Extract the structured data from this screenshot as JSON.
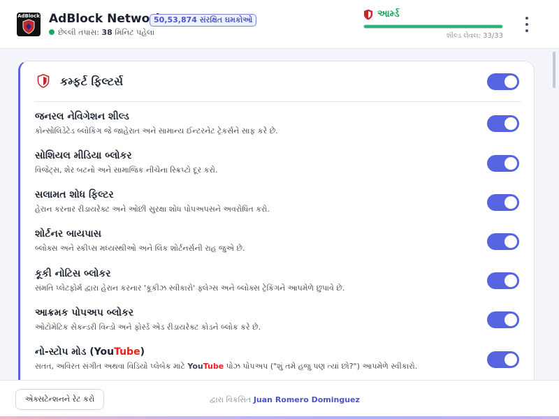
{
  "header": {
    "logo_text": "AdBlock",
    "app_title": "AdBlock Network",
    "users_badge": "50,53,874 સંરક્ષિત ઘમકોઓ",
    "status_prefix": "છેલ્લી તપાસ:",
    "status_value": "38",
    "status_suffix": "મિનિટ પહેલાં",
    "armed_label": "આર્મ્ડ",
    "shield_level": "શીલ્ડ લેવલ: 33/33",
    "shield_progress": 1.0
  },
  "card": {
    "title": "કમ્ફર્ટ ફિલ્ટર્સ",
    "master_enabled": true,
    "filters": [
      {
        "name": "જનરલ નેવિગેશન શીલ્ડ",
        "desc": "કોન્સોલિડેટેડ બ્લોકિંગ જે જાહેરાત અને સામાન્ય ઈન્ટરનેટ ટ્રેકર્સને સાફ કરે છે.",
        "enabled": true
      },
      {
        "name": "સોશિયલ મીડિયા બ્લોકર",
        "desc": "વિજેટ્સ, શેર બટનો અને સામાજિક નીચેના સ્ક્રિપ્ટો દૂર કરો.",
        "enabled": true
      },
      {
        "name": "સલામત શોધ ફિલ્ટર",
        "desc": "હેરાન કરનાર રીડાયરેક્ટ અને ઓછી સુરક્ષા શોધ પોપઅપસને અવરોધિત કરો.",
        "enabled": true
      },
      {
        "name": "શોર્ટનર બાયપાસ",
        "desc": "બ્લોક્સ અને સ્કીપ્સ મધ્યસ્થીઓ અને લિંક શોર્ટનર્સની રાહ જુએ છે.",
        "enabled": true
      },
      {
        "name": "કૂકી નોટિસ બ્લોકર",
        "desc": "સંમતિ પ્લેટફોર્મ દ્વારા હેરાન કરનાર 'કૂકીઝ સ્વીકારો' ફ્લેગ્સ અને બ્લોક્સ ટ્રેકિંગને આપમેળે છુપાવે છે.",
        "enabled": true
      },
      {
        "name": "આક્રમક પોપઅપ બ્લોકર",
        "desc": "ઓટોમેટિક સેકન્ડરી વિન્ડો અને ફોર્સ્ડ એડ રીડાયરેક્ટ કોડને બ્લોક કરે છે.",
        "enabled": true
      },
      {
        "name_prefix": "નો-સ્ટોપ મોડ (",
        "yt_a": "You",
        "yt_b": "Tube",
        "name_suffix": ")",
        "desc_prefix": "સતત, અવિરત સંગીત અથવા વિડિયો પ્લેબેક માટે ",
        "desc_suffix": " પોઝ પોપઅપ (\"શું તમે હજુ પણ ત્યાં છો?\") આપમેળે સ્વીકારો.",
        "enabled": true
      }
    ]
  },
  "footer": {
    "rate_button": "એક્સટેન્શનને રેટ કરો",
    "developer_prefix": "દ્વારા વિકસિત",
    "developer_name": "Juan Romero Dominguez"
  },
  "colors": {
    "accent": "#5664e0",
    "armed": "#1fa463",
    "youtube_red": "#e62117",
    "shield_red": "#c62828"
  }
}
